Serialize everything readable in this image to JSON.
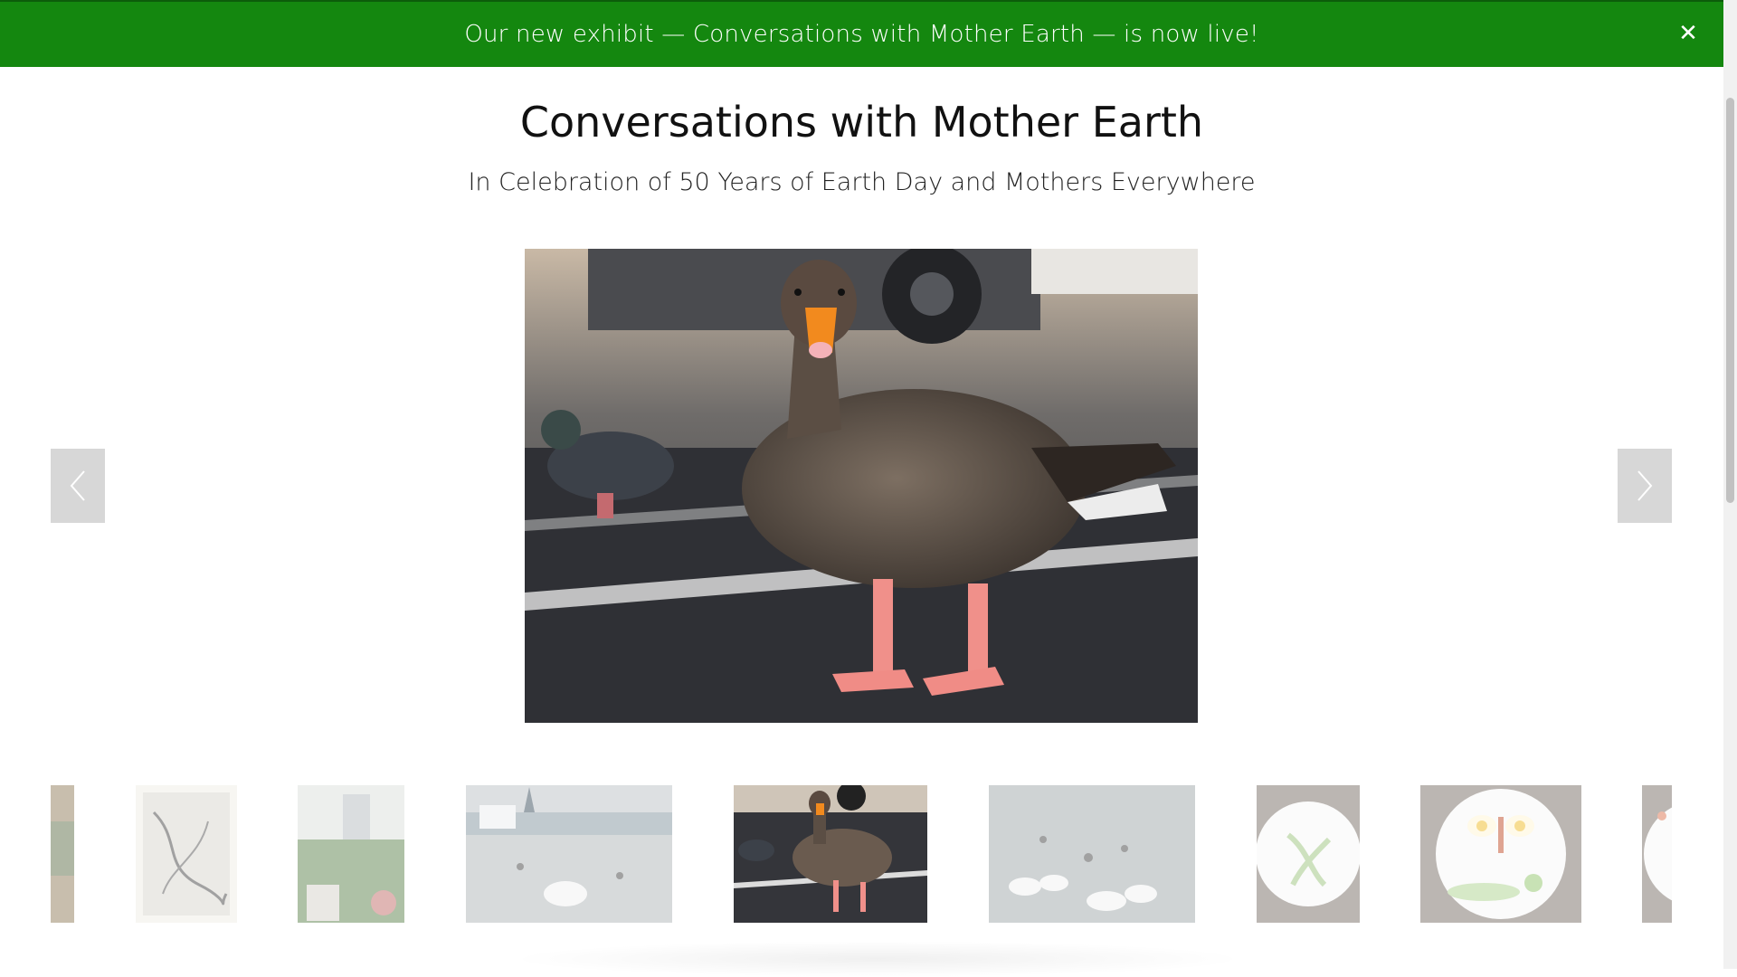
{
  "banner": {
    "text": "Our new exhibit — Conversations with Mother Earth — is now live!",
    "close_icon": "close-icon",
    "background_color": "#14870f"
  },
  "header": {
    "title": "Conversations with Mother Earth",
    "subtitle": "In Celebration of 50 Years of Earth Day and Mothers Everywhere"
  },
  "gallery": {
    "main_image_subject": "goose",
    "prev_icon": "chevron-left-icon",
    "next_icon": "chevron-right-icon",
    "thumbnails": [
      {
        "subject": "partial-painting",
        "selected": false
      },
      {
        "subject": "sketch-drawing",
        "selected": false
      },
      {
        "subject": "garden-collage",
        "selected": false
      },
      {
        "subject": "swan-lake-church",
        "selected": false
      },
      {
        "subject": "goose",
        "selected": true
      },
      {
        "subject": "swans-on-water",
        "selected": false
      },
      {
        "subject": "plate-cucumber-art",
        "selected": false
      },
      {
        "subject": "plate-egg-butterfly",
        "selected": false
      },
      {
        "subject": "partial-plate",
        "selected": false
      }
    ]
  }
}
